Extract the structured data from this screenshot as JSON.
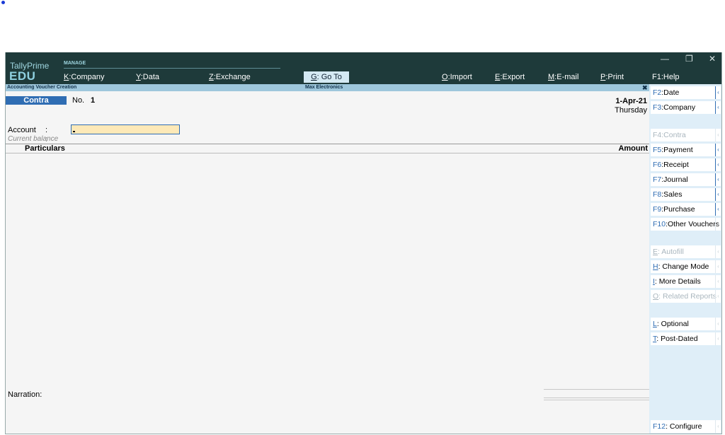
{
  "app": {
    "brand_line1": "TallyPrime",
    "brand_line2": "EDU",
    "section": "MANAGE"
  },
  "menu": [
    {
      "key": "K",
      "label": ":Company"
    },
    {
      "key": "Y",
      "label": ":Data"
    },
    {
      "key": "Z",
      "label": ":Exchange"
    },
    {
      "key": "G",
      "label": ": Go To"
    },
    {
      "key": "O",
      "label": ":Import"
    },
    {
      "key": "E",
      "label": ":Export"
    },
    {
      "key": "M",
      "label": ":E-mail"
    },
    {
      "key": "P",
      "label": ":Print"
    },
    {
      "key": "F1",
      "label": ":Help"
    }
  ],
  "window": {
    "minimize": "—",
    "restore": "❐",
    "close": "✕"
  },
  "title_strip": {
    "left": "Accounting Voucher Creation",
    "center": "Max Electronics",
    "close": "✖"
  },
  "voucher": {
    "type": "Contra",
    "no_label": "No.",
    "no_value": "1",
    "date": "1-Apr-21",
    "day": "Thursday",
    "account_label": "Account",
    "account_colon": ":",
    "current_balance_label": "Current balance",
    "current_balance_colon": ":",
    "particulars_header": "Particulars",
    "amount_header": "Amount",
    "narration_label": "Narration:"
  },
  "right_buttons": [
    {
      "key": "F2",
      "label": ":Date",
      "enabled": true,
      "arrow": "‹"
    },
    {
      "key": "F3",
      "label": ":Company",
      "enabled": true,
      "arrow": "‹"
    },
    {
      "key": "F4",
      "label": ":Contra",
      "enabled": false,
      "arrow": "‹"
    },
    {
      "key": "F5",
      "label": ":Payment",
      "enabled": true,
      "arrow": "‹"
    },
    {
      "key": "F6",
      "label": ":Receipt",
      "enabled": true,
      "arrow": "‹"
    },
    {
      "key": "F7",
      "label": ":Journal",
      "enabled": true,
      "arrow": "‹"
    },
    {
      "key": "F8",
      "label": ":Sales",
      "enabled": true,
      "arrow": "‹"
    },
    {
      "key": "F9",
      "label": ":Purchase",
      "enabled": true,
      "arrow": "‹"
    },
    {
      "key": "F10",
      "label": ":Other Vouchers",
      "enabled": true,
      "arrow": "‹"
    },
    {
      "key": "E",
      "label": ": Autofill",
      "enabled": false,
      "arrow": "‹"
    },
    {
      "key": "H",
      "label": ": Change Mode",
      "enabled": true,
      "arrow": "‹"
    },
    {
      "key": "I",
      "label": ": More Details",
      "enabled": true,
      "arrow": "‹"
    },
    {
      "key": "O",
      "label": ": Related Reports",
      "enabled": false,
      "arrow": "‹"
    },
    {
      "key": "L",
      "label": ": Optional",
      "enabled": true,
      "arrow": "‹"
    },
    {
      "key": "T",
      "label": ": Post-Dated",
      "enabled": true,
      "arrow": "‹"
    },
    {
      "key": "F12",
      "label": ": Configure",
      "enabled": true,
      "arrow": "‹"
    }
  ],
  "colors": {
    "header_bg": "#1e3a3a",
    "accent": "#2f6db3",
    "strip": "#9ec7dc",
    "button_bar": "#dfeef8",
    "input_bg": "#fde9b8"
  }
}
